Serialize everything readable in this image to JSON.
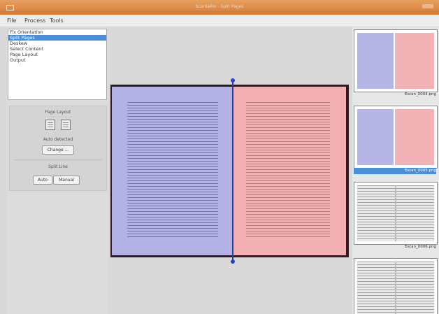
{
  "window": {
    "title": "Scantailor - Split Pages"
  },
  "menu": [
    "File",
    "Process",
    "Tools"
  ],
  "steps": {
    "items": [
      "Fix Orientation",
      "Split Pages",
      "Deskew",
      "Select Content",
      "Page Layout",
      "Output"
    ],
    "selected_index": 1
  },
  "options": {
    "page_layout_label": "Page Layout",
    "auto_detected_label": "Auto detected",
    "change_label": "Change ...",
    "split_line_label": "Split Line",
    "auto_label": "Auto",
    "manual_label": "Manual"
  },
  "thumbnails": [
    {
      "name": "Escan_0004.png",
      "status": "split"
    },
    {
      "name": "Escan_0005.png",
      "status": "split",
      "selected": true
    },
    {
      "name": "Escan_0006.png",
      "status": "unsplit"
    },
    {
      "name": "",
      "status": "unsplit"
    }
  ],
  "colors": {
    "left_page": "#b5b2e6",
    "right_page": "#f2b0b3",
    "selection": "#4a90d9",
    "split_line": "#2a3c9c"
  }
}
